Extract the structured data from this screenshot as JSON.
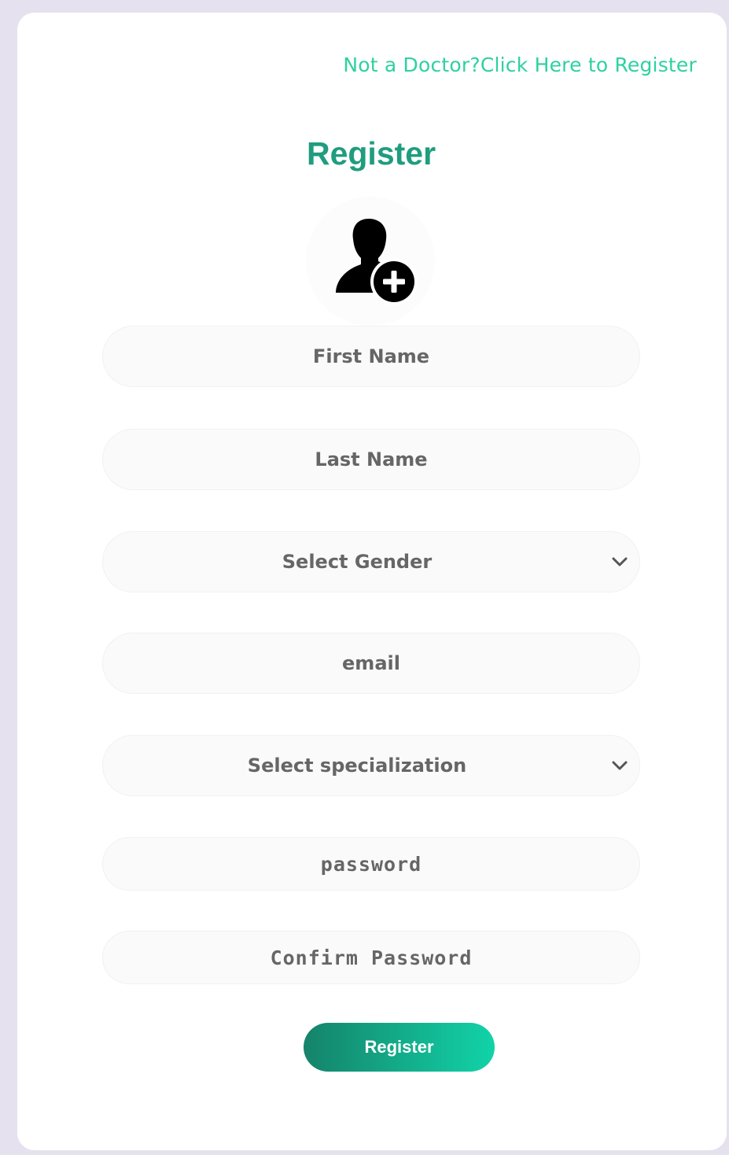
{
  "header": {
    "alt_register_link": "Not a Doctor?Click Here to Register",
    "title": "Register"
  },
  "avatar": {
    "icon": "add-user-icon"
  },
  "form": {
    "first_name_placeholder": "First Name",
    "last_name_placeholder": "Last Name",
    "gender_selected": "Select Gender",
    "email_placeholder": "email",
    "specialization_selected": "Select specialization",
    "password_placeholder": "password",
    "confirm_password_placeholder": "Confirm Password",
    "submit_label": "Register"
  },
  "colors": {
    "accent": "#1f9d7e",
    "link": "#2ed1a0",
    "button_start": "#15836a",
    "button_end": "#11d3a8"
  }
}
